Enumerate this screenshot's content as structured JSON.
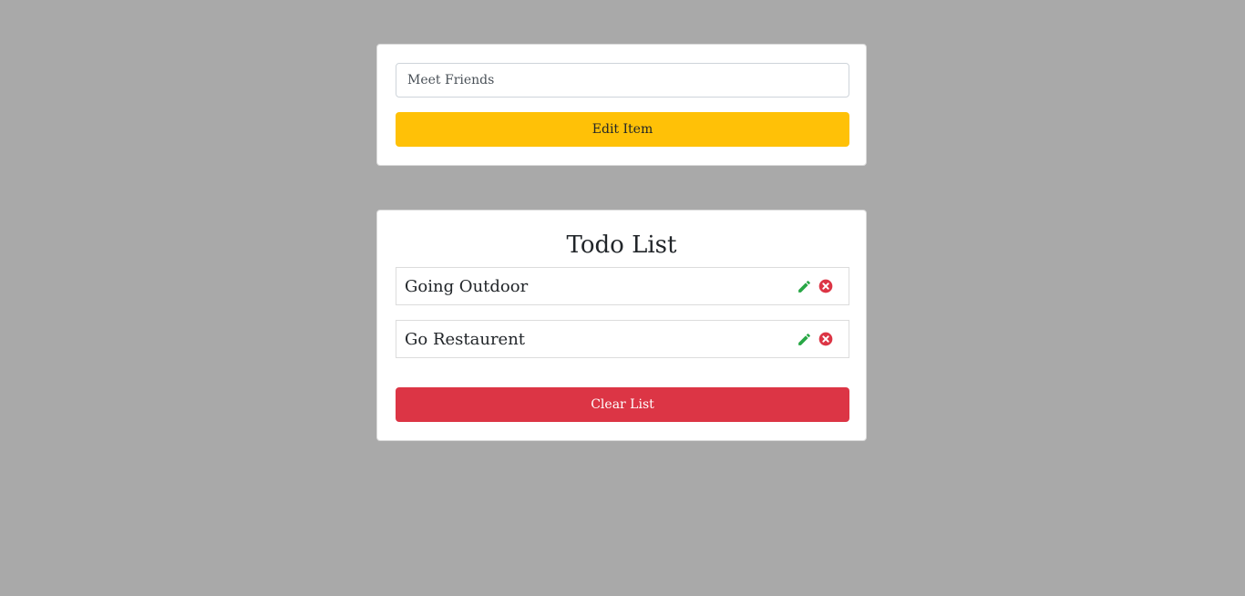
{
  "form": {
    "input_value": "Meet Friends",
    "submit_label": "Edit Item"
  },
  "list": {
    "title": "Todo List",
    "items": [
      {
        "text": "Going Outdoor"
      },
      {
        "text": "Go Restaurent"
      }
    ],
    "clear_label": "Clear List"
  },
  "colors": {
    "background": "#a9a9a9",
    "edit_button": "#ffc107",
    "clear_button": "#dc3545",
    "edit_icon": "#28a745",
    "delete_icon": "#dc3545"
  },
  "icons": {
    "edit": "pencil-icon",
    "delete": "close-circle-icon"
  }
}
